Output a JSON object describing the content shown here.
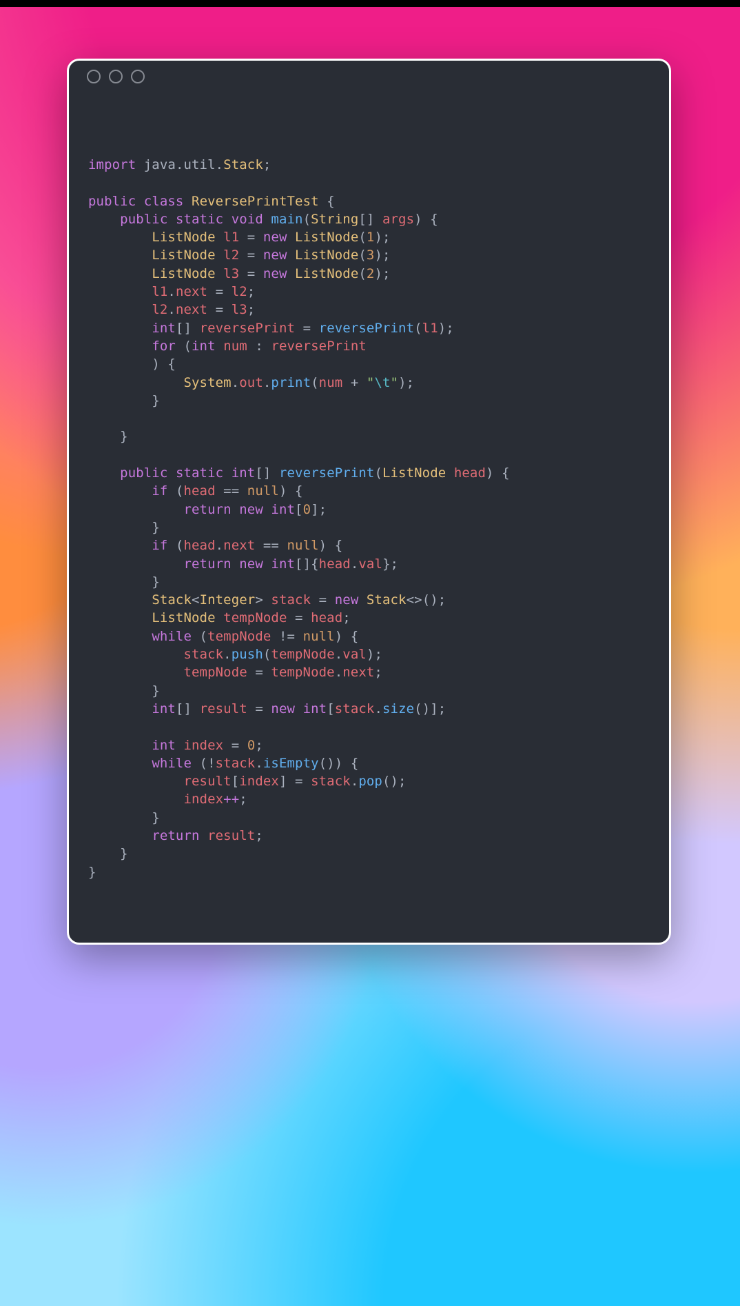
{
  "window": {
    "traffic_lights": [
      "close",
      "minimize",
      "zoom"
    ]
  },
  "code": {
    "language": "java",
    "tokens": [
      {
        "t": "kw",
        "v": "import"
      },
      {
        "t": "pun",
        "v": " java"
      },
      {
        "t": "pun",
        "v": "."
      },
      {
        "t": "pun",
        "v": "util"
      },
      {
        "t": "pun",
        "v": "."
      },
      {
        "t": "ty",
        "v": "Stack"
      },
      {
        "t": "pun",
        "v": ";"
      },
      {
        "t": "nl"
      },
      {
        "t": "nl"
      },
      {
        "t": "kw",
        "v": "public"
      },
      {
        "t": "sp"
      },
      {
        "t": "kw",
        "v": "class"
      },
      {
        "t": "sp"
      },
      {
        "t": "id",
        "v": "ReversePrintTest"
      },
      {
        "t": "sp"
      },
      {
        "t": "pun",
        "v": "{"
      },
      {
        "t": "nl"
      },
      {
        "t": "ind",
        "n": 1
      },
      {
        "t": "kw",
        "v": "public"
      },
      {
        "t": "sp"
      },
      {
        "t": "kw",
        "v": "static"
      },
      {
        "t": "sp"
      },
      {
        "t": "kw",
        "v": "void"
      },
      {
        "t": "sp"
      },
      {
        "t": "fn",
        "v": "main"
      },
      {
        "t": "pun",
        "v": "("
      },
      {
        "t": "ty",
        "v": "String"
      },
      {
        "t": "pun",
        "v": "[] "
      },
      {
        "t": "var",
        "v": "args"
      },
      {
        "t": "pun",
        "v": ") {"
      },
      {
        "t": "nl"
      },
      {
        "t": "ind",
        "n": 2
      },
      {
        "t": "ty",
        "v": "ListNode"
      },
      {
        "t": "sp"
      },
      {
        "t": "var",
        "v": "l1"
      },
      {
        "t": "pun",
        "v": " = "
      },
      {
        "t": "kw",
        "v": "new"
      },
      {
        "t": "sp"
      },
      {
        "t": "ty",
        "v": "ListNode"
      },
      {
        "t": "pun",
        "v": "("
      },
      {
        "t": "num",
        "v": "1"
      },
      {
        "t": "pun",
        "v": ");"
      },
      {
        "t": "nl"
      },
      {
        "t": "ind",
        "n": 2
      },
      {
        "t": "ty",
        "v": "ListNode"
      },
      {
        "t": "sp"
      },
      {
        "t": "var",
        "v": "l2"
      },
      {
        "t": "pun",
        "v": " = "
      },
      {
        "t": "kw",
        "v": "new"
      },
      {
        "t": "sp"
      },
      {
        "t": "ty",
        "v": "ListNode"
      },
      {
        "t": "pun",
        "v": "("
      },
      {
        "t": "num",
        "v": "3"
      },
      {
        "t": "pun",
        "v": ");"
      },
      {
        "t": "nl"
      },
      {
        "t": "ind",
        "n": 2
      },
      {
        "t": "ty",
        "v": "ListNode"
      },
      {
        "t": "sp"
      },
      {
        "t": "var",
        "v": "l3"
      },
      {
        "t": "pun",
        "v": " = "
      },
      {
        "t": "kw",
        "v": "new"
      },
      {
        "t": "sp"
      },
      {
        "t": "ty",
        "v": "ListNode"
      },
      {
        "t": "pun",
        "v": "("
      },
      {
        "t": "num",
        "v": "2"
      },
      {
        "t": "pun",
        "v": ");"
      },
      {
        "t": "nl"
      },
      {
        "t": "ind",
        "n": 2
      },
      {
        "t": "var",
        "v": "l1"
      },
      {
        "t": "pun",
        "v": "."
      },
      {
        "t": "var",
        "v": "next"
      },
      {
        "t": "pun",
        "v": " = "
      },
      {
        "t": "var",
        "v": "l2"
      },
      {
        "t": "pun",
        "v": ";"
      },
      {
        "t": "nl"
      },
      {
        "t": "ind",
        "n": 2
      },
      {
        "t": "var",
        "v": "l2"
      },
      {
        "t": "pun",
        "v": "."
      },
      {
        "t": "var",
        "v": "next"
      },
      {
        "t": "pun",
        "v": " = "
      },
      {
        "t": "var",
        "v": "l3"
      },
      {
        "t": "pun",
        "v": ";"
      },
      {
        "t": "nl"
      },
      {
        "t": "ind",
        "n": 2
      },
      {
        "t": "kw",
        "v": "int"
      },
      {
        "t": "pun",
        "v": "[] "
      },
      {
        "t": "var",
        "v": "reversePrint"
      },
      {
        "t": "pun",
        "v": " = "
      },
      {
        "t": "fn",
        "v": "reversePrint"
      },
      {
        "t": "pun",
        "v": "("
      },
      {
        "t": "var",
        "v": "l1"
      },
      {
        "t": "pun",
        "v": ");"
      },
      {
        "t": "nl"
      },
      {
        "t": "ind",
        "n": 2
      },
      {
        "t": "kw",
        "v": "for"
      },
      {
        "t": "pun",
        "v": " ("
      },
      {
        "t": "kw",
        "v": "int"
      },
      {
        "t": "sp"
      },
      {
        "t": "var",
        "v": "num"
      },
      {
        "t": "pun",
        "v": " : "
      },
      {
        "t": "var",
        "v": "reversePrint"
      },
      {
        "t": "nl"
      },
      {
        "t": "ind",
        "n": 2
      },
      {
        "t": "pun",
        "v": ") {"
      },
      {
        "t": "nl"
      },
      {
        "t": "ind",
        "n": 3
      },
      {
        "t": "ty",
        "v": "System"
      },
      {
        "t": "pun",
        "v": "."
      },
      {
        "t": "var",
        "v": "out"
      },
      {
        "t": "pun",
        "v": "."
      },
      {
        "t": "fn",
        "v": "print"
      },
      {
        "t": "pun",
        "v": "("
      },
      {
        "t": "var",
        "v": "num"
      },
      {
        "t": "pun",
        "v": " + "
      },
      {
        "t": "str",
        "v": "\""
      },
      {
        "t": "esc",
        "v": "\\t"
      },
      {
        "t": "str",
        "v": "\""
      },
      {
        "t": "pun",
        "v": ");"
      },
      {
        "t": "nl"
      },
      {
        "t": "ind",
        "n": 2
      },
      {
        "t": "pun",
        "v": "}"
      },
      {
        "t": "nl"
      },
      {
        "t": "nl"
      },
      {
        "t": "ind",
        "n": 1
      },
      {
        "t": "pun",
        "v": "}"
      },
      {
        "t": "nl"
      },
      {
        "t": "nl"
      },
      {
        "t": "ind",
        "n": 1
      },
      {
        "t": "kw",
        "v": "public"
      },
      {
        "t": "sp"
      },
      {
        "t": "kw",
        "v": "static"
      },
      {
        "t": "sp"
      },
      {
        "t": "kw",
        "v": "int"
      },
      {
        "t": "pun",
        "v": "[] "
      },
      {
        "t": "fn",
        "v": "reversePrint"
      },
      {
        "t": "pun",
        "v": "("
      },
      {
        "t": "ty",
        "v": "ListNode"
      },
      {
        "t": "sp"
      },
      {
        "t": "var",
        "v": "head"
      },
      {
        "t": "pun",
        "v": ") {"
      },
      {
        "t": "nl"
      },
      {
        "t": "ind",
        "n": 2
      },
      {
        "t": "kw",
        "v": "if"
      },
      {
        "t": "pun",
        "v": " ("
      },
      {
        "t": "var",
        "v": "head"
      },
      {
        "t": "pun",
        "v": " == "
      },
      {
        "t": "nul",
        "v": "null"
      },
      {
        "t": "pun",
        "v": ") {"
      },
      {
        "t": "nl"
      },
      {
        "t": "ind",
        "n": 3
      },
      {
        "t": "kw",
        "v": "return"
      },
      {
        "t": "sp"
      },
      {
        "t": "kw",
        "v": "new"
      },
      {
        "t": "sp"
      },
      {
        "t": "kw",
        "v": "int"
      },
      {
        "t": "pun",
        "v": "["
      },
      {
        "t": "num",
        "v": "0"
      },
      {
        "t": "pun",
        "v": "];"
      },
      {
        "t": "nl"
      },
      {
        "t": "ind",
        "n": 2
      },
      {
        "t": "pun",
        "v": "}"
      },
      {
        "t": "nl"
      },
      {
        "t": "ind",
        "n": 2
      },
      {
        "t": "kw",
        "v": "if"
      },
      {
        "t": "pun",
        "v": " ("
      },
      {
        "t": "var",
        "v": "head"
      },
      {
        "t": "pun",
        "v": "."
      },
      {
        "t": "var",
        "v": "next"
      },
      {
        "t": "pun",
        "v": " == "
      },
      {
        "t": "nul",
        "v": "null"
      },
      {
        "t": "pun",
        "v": ") {"
      },
      {
        "t": "nl"
      },
      {
        "t": "ind",
        "n": 3
      },
      {
        "t": "kw",
        "v": "return"
      },
      {
        "t": "sp"
      },
      {
        "t": "kw",
        "v": "new"
      },
      {
        "t": "sp"
      },
      {
        "t": "kw",
        "v": "int"
      },
      {
        "t": "pun",
        "v": "[]{"
      },
      {
        "t": "var",
        "v": "head"
      },
      {
        "t": "pun",
        "v": "."
      },
      {
        "t": "var",
        "v": "val"
      },
      {
        "t": "pun",
        "v": "};"
      },
      {
        "t": "nl"
      },
      {
        "t": "ind",
        "n": 2
      },
      {
        "t": "pun",
        "v": "}"
      },
      {
        "t": "nl"
      },
      {
        "t": "ind",
        "n": 2
      },
      {
        "t": "ty",
        "v": "Stack"
      },
      {
        "t": "pun",
        "v": "<"
      },
      {
        "t": "ty",
        "v": "Integer"
      },
      {
        "t": "pun",
        "v": "> "
      },
      {
        "t": "var",
        "v": "stack"
      },
      {
        "t": "pun",
        "v": " = "
      },
      {
        "t": "kw",
        "v": "new"
      },
      {
        "t": "sp"
      },
      {
        "t": "ty",
        "v": "Stack"
      },
      {
        "t": "pun",
        "v": "<>();"
      },
      {
        "t": "nl"
      },
      {
        "t": "ind",
        "n": 2
      },
      {
        "t": "ty",
        "v": "ListNode"
      },
      {
        "t": "sp"
      },
      {
        "t": "var",
        "v": "tempNode"
      },
      {
        "t": "pun",
        "v": " = "
      },
      {
        "t": "var",
        "v": "head"
      },
      {
        "t": "pun",
        "v": ";"
      },
      {
        "t": "nl"
      },
      {
        "t": "ind",
        "n": 2
      },
      {
        "t": "kw",
        "v": "while"
      },
      {
        "t": "pun",
        "v": " ("
      },
      {
        "t": "var",
        "v": "tempNode"
      },
      {
        "t": "pun",
        "v": " != "
      },
      {
        "t": "nul",
        "v": "null"
      },
      {
        "t": "pun",
        "v": ") {"
      },
      {
        "t": "nl"
      },
      {
        "t": "ind",
        "n": 3
      },
      {
        "t": "var",
        "v": "stack"
      },
      {
        "t": "pun",
        "v": "."
      },
      {
        "t": "fn",
        "v": "push"
      },
      {
        "t": "pun",
        "v": "("
      },
      {
        "t": "var",
        "v": "tempNode"
      },
      {
        "t": "pun",
        "v": "."
      },
      {
        "t": "var",
        "v": "val"
      },
      {
        "t": "pun",
        "v": ");"
      },
      {
        "t": "nl"
      },
      {
        "t": "ind",
        "n": 3
      },
      {
        "t": "var",
        "v": "tempNode"
      },
      {
        "t": "pun",
        "v": " = "
      },
      {
        "t": "var",
        "v": "tempNode"
      },
      {
        "t": "pun",
        "v": "."
      },
      {
        "t": "var",
        "v": "next"
      },
      {
        "t": "pun",
        "v": ";"
      },
      {
        "t": "nl"
      },
      {
        "t": "ind",
        "n": 2
      },
      {
        "t": "pun",
        "v": "}"
      },
      {
        "t": "nl"
      },
      {
        "t": "ind",
        "n": 2
      },
      {
        "t": "kw",
        "v": "int"
      },
      {
        "t": "pun",
        "v": "[] "
      },
      {
        "t": "var",
        "v": "result"
      },
      {
        "t": "pun",
        "v": " = "
      },
      {
        "t": "kw",
        "v": "new"
      },
      {
        "t": "sp"
      },
      {
        "t": "kw",
        "v": "int"
      },
      {
        "t": "pun",
        "v": "["
      },
      {
        "t": "var",
        "v": "stack"
      },
      {
        "t": "pun",
        "v": "."
      },
      {
        "t": "fn",
        "v": "size"
      },
      {
        "t": "pun",
        "v": "()];"
      },
      {
        "t": "nl"
      },
      {
        "t": "nl"
      },
      {
        "t": "ind",
        "n": 2
      },
      {
        "t": "kw",
        "v": "int"
      },
      {
        "t": "sp"
      },
      {
        "t": "var",
        "v": "index"
      },
      {
        "t": "pun",
        "v": " = "
      },
      {
        "t": "num",
        "v": "0"
      },
      {
        "t": "pun",
        "v": ";"
      },
      {
        "t": "nl"
      },
      {
        "t": "ind",
        "n": 2
      },
      {
        "t": "kw",
        "v": "while"
      },
      {
        "t": "pun",
        "v": " (!"
      },
      {
        "t": "var",
        "v": "stack"
      },
      {
        "t": "pun",
        "v": "."
      },
      {
        "t": "fn",
        "v": "isEmpty"
      },
      {
        "t": "pun",
        "v": "()) {"
      },
      {
        "t": "nl"
      },
      {
        "t": "ind",
        "n": 3
      },
      {
        "t": "var",
        "v": "result"
      },
      {
        "t": "pun",
        "v": "["
      },
      {
        "t": "var",
        "v": "index"
      },
      {
        "t": "pun",
        "v": "] = "
      },
      {
        "t": "var",
        "v": "stack"
      },
      {
        "t": "pun",
        "v": "."
      },
      {
        "t": "fn",
        "v": "pop"
      },
      {
        "t": "pun",
        "v": "();"
      },
      {
        "t": "nl"
      },
      {
        "t": "ind",
        "n": 3
      },
      {
        "t": "var",
        "v": "index"
      },
      {
        "t": "op",
        "v": "++"
      },
      {
        "t": "pun",
        "v": ";"
      },
      {
        "t": "nl"
      },
      {
        "t": "ind",
        "n": 2
      },
      {
        "t": "pun",
        "v": "}"
      },
      {
        "t": "nl"
      },
      {
        "t": "ind",
        "n": 2
      },
      {
        "t": "kw",
        "v": "return"
      },
      {
        "t": "sp"
      },
      {
        "t": "var",
        "v": "result"
      },
      {
        "t": "pun",
        "v": ";"
      },
      {
        "t": "nl"
      },
      {
        "t": "ind",
        "n": 1
      },
      {
        "t": "pun",
        "v": "}"
      },
      {
        "t": "nl"
      },
      {
        "t": "pun",
        "v": "}"
      }
    ]
  }
}
